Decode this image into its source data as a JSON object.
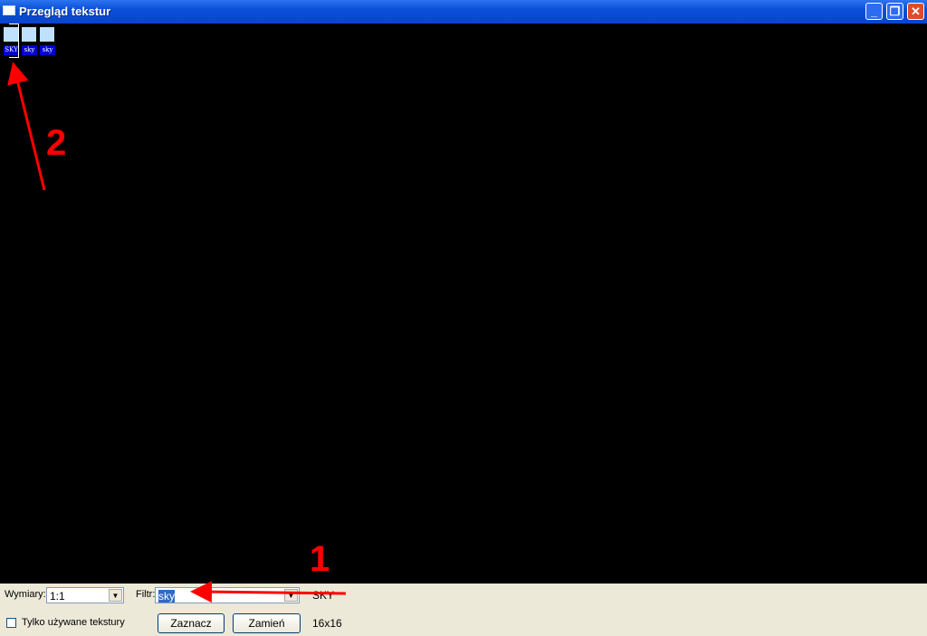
{
  "window": {
    "title": "Przegląd tekstur",
    "icon": "window-icon",
    "buttons": [
      "minimize",
      "restore",
      "close"
    ]
  },
  "textures": [
    {
      "label": "SKY",
      "selected": true
    },
    {
      "label": "sky",
      "selected": false
    },
    {
      "label": "sky",
      "selected": false
    }
  ],
  "panel": {
    "size_label": "Wymiary:",
    "size_value": "1:1",
    "filter_label": "Filtr:",
    "filter_value": "sky",
    "selected_name": "SKY",
    "only_used_label": "Tylko używane tekstury",
    "only_used_checked": false,
    "select_button": "Zaznacz",
    "replace_button": "Zamień",
    "dimensions": "16x16"
  },
  "annotations": {
    "color": "#ff0000",
    "labels": [
      "1",
      "2"
    ]
  }
}
